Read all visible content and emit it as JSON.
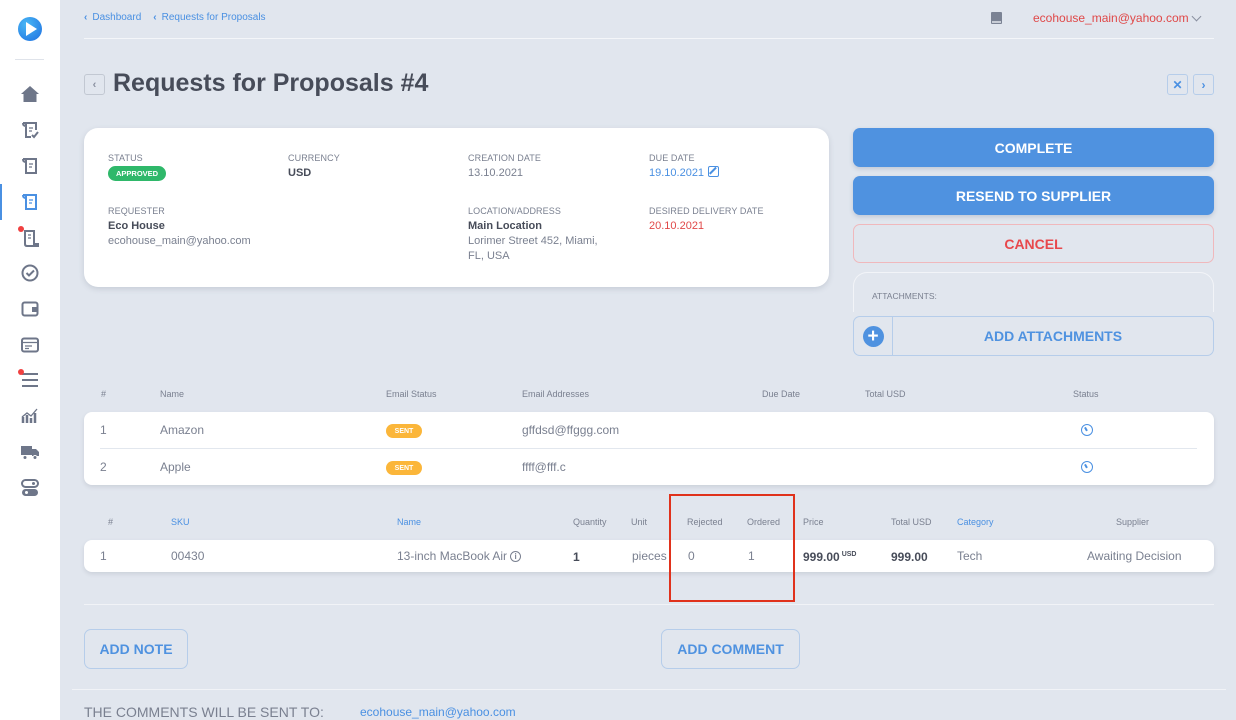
{
  "sidebar": {
    "items": [
      {
        "name": "home",
        "icon": "home-icon"
      },
      {
        "name": "requisitions",
        "icon": "document-check-icon"
      },
      {
        "name": "documents",
        "icon": "document-icon"
      },
      {
        "name": "requests-for-proposals",
        "icon": "document-icon",
        "active": true
      },
      {
        "name": "orders",
        "icon": "scroll-icon",
        "notification": true
      },
      {
        "name": "approvals",
        "icon": "check-circle-icon"
      },
      {
        "name": "wallet",
        "icon": "wallet-icon"
      },
      {
        "name": "invoices",
        "icon": "card-icon"
      },
      {
        "name": "lists",
        "icon": "list-icon",
        "notification": true
      },
      {
        "name": "analytics",
        "icon": "chart-icon"
      },
      {
        "name": "delivery",
        "icon": "truck-icon"
      },
      {
        "name": "settings",
        "icon": "toggle-icon"
      }
    ]
  },
  "header": {
    "breadcrumbs": [
      "Dashboard",
      "Requests for Proposals"
    ],
    "user_email": "ecohouse_main@yahoo.com"
  },
  "page": {
    "title": "Requests for Proposals #4",
    "back_glyph": "‹",
    "close_glyph": "✕",
    "next_glyph": "›"
  },
  "info": {
    "status_label": "STATUS",
    "status_value": "APPROVED",
    "currency_label": "CURRENCY",
    "currency_value": "USD",
    "creation_date_label": "CREATION DATE",
    "creation_date_value": "13.10.2021",
    "due_date_label": "DUE DATE",
    "due_date_value": "19.10.2021",
    "requester_label": "REQUESTER",
    "requester_name": "Eco House",
    "requester_email": "ecohouse_main@yahoo.com",
    "location_label": "LOCATION/ADDRESS",
    "location_name": "Main Location",
    "location_address_1": "Lorimer Street 452, Miami,",
    "location_address_2": "FL, USA",
    "delivery_label": "DESIRED DELIVERY DATE",
    "delivery_value": "20.10.2021"
  },
  "actions": {
    "complete": "COMPLETE",
    "resend": "RESEND TO SUPPLIER",
    "cancel": "CANCEL",
    "attachments_label": "ATTACHMENTS:",
    "add_attachments": "ADD ATTACHMENTS",
    "plus_glyph": "+"
  },
  "suppliers_table": {
    "headers": [
      "#",
      "Name",
      "Email Status",
      "Email Addresses",
      "Due Date",
      "Total USD",
      "Status"
    ],
    "rows": [
      {
        "num": "1",
        "name": "Amazon",
        "email_status": "SENT",
        "email": "gffdsd@ffggg.com",
        "due_date": "",
        "total": "",
        "status_icon": "clock-icon"
      },
      {
        "num": "2",
        "name": "Apple",
        "email_status": "SENT",
        "email": "ffff@fff.c",
        "due_date": "",
        "total": "",
        "status_icon": "clock-icon"
      }
    ]
  },
  "items_table": {
    "headers": [
      "#",
      "SKU",
      "Name",
      "Quantity",
      "Unit",
      "Rejected",
      "Ordered",
      "Price",
      "Total USD",
      "Category",
      "Supplier"
    ],
    "rows": [
      {
        "num": "1",
        "sku": "00430",
        "name": "13-inch MacBook Air",
        "quantity": "1",
        "unit": "pieces",
        "rejected": "0",
        "ordered": "1",
        "price": "999.00",
        "price_currency": "USD",
        "total": "999.00",
        "category": "Tech",
        "supplier": "Awaiting Decision"
      }
    ]
  },
  "footer": {
    "add_note": "ADD NOTE",
    "add_comment": "ADD COMMENT",
    "comments_label": "THE COMMENTS WILL BE SENT TO:",
    "comments_email": "ecohouse_main@yahoo.com"
  },
  "colors": {
    "accent": "#4f92e0",
    "danger": "#e8484c",
    "approved": "#2fb86a",
    "sent": "#fbb63a",
    "highlight": "#e0321c"
  }
}
